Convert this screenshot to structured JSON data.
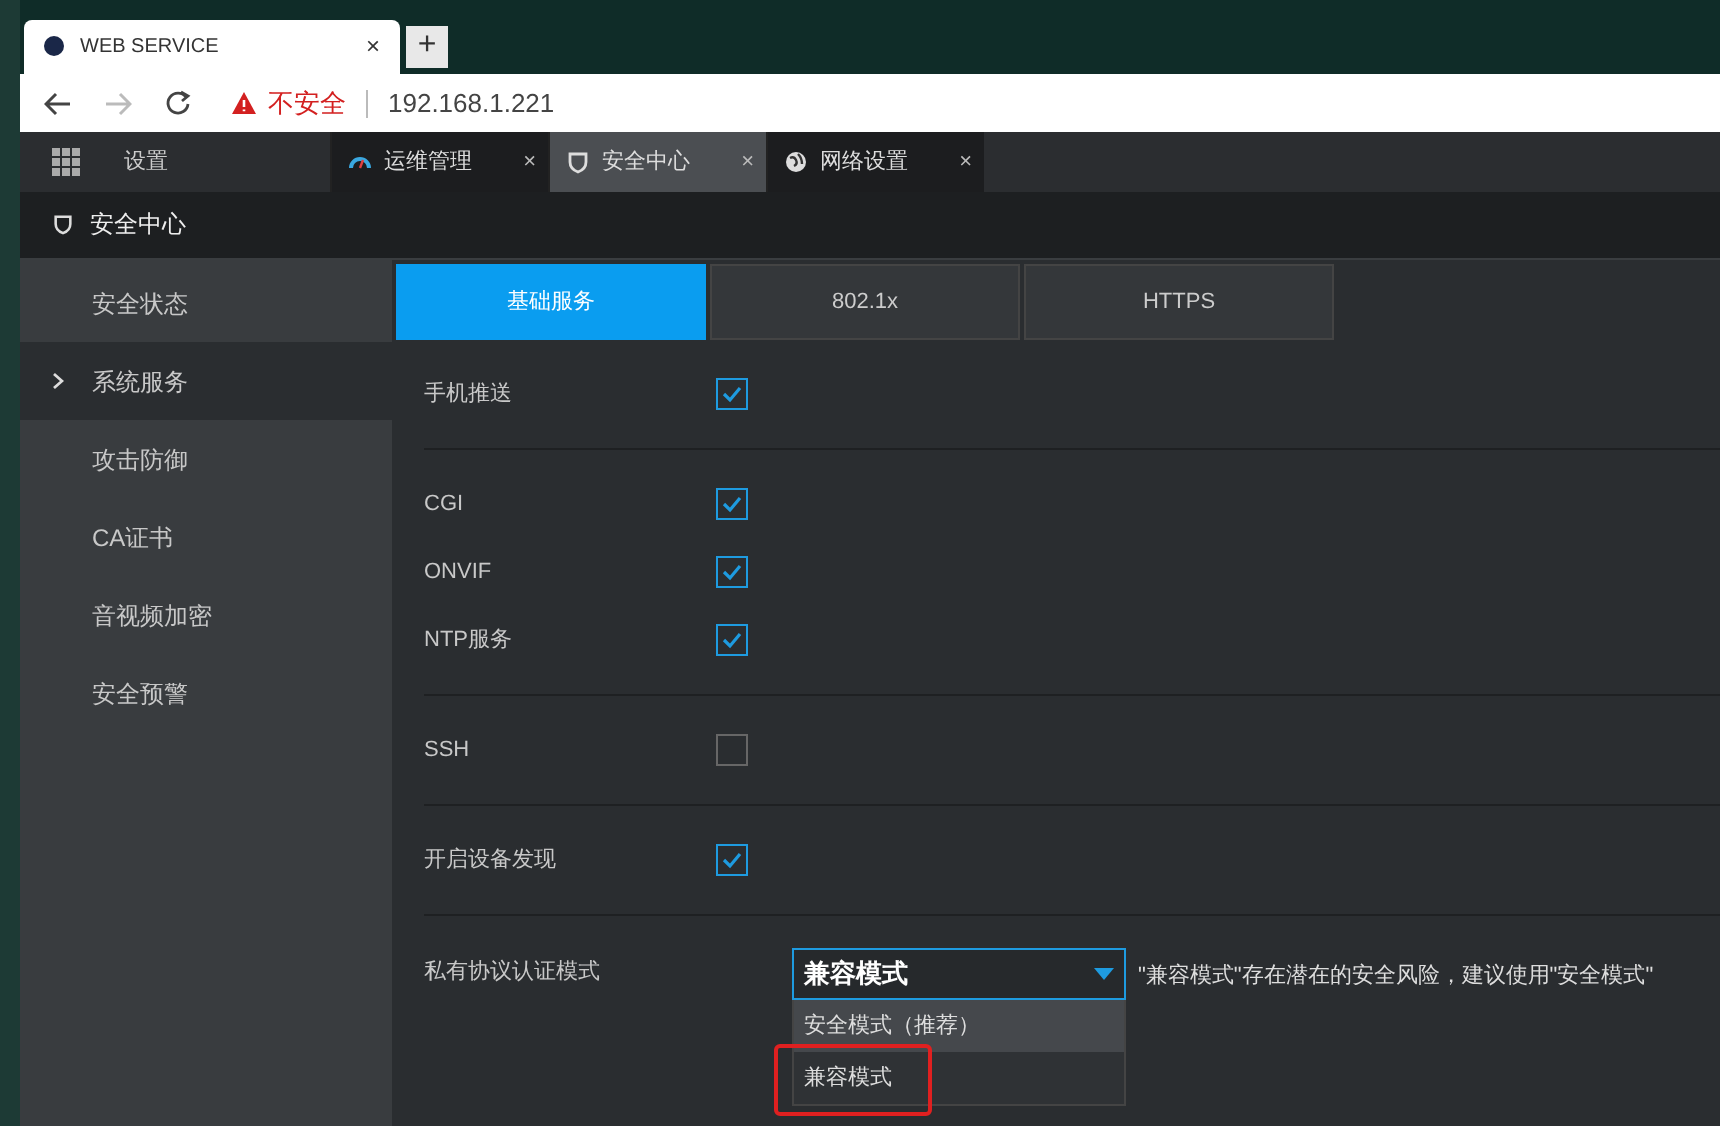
{
  "browser": {
    "tab_title": "WEB SERVICE",
    "security_label": "不安全",
    "address": "192.168.1.221",
    "new_tab": "+",
    "tab_close": "×"
  },
  "app_tabs": {
    "home_label": "设置",
    "tabs": [
      {
        "label": "运维管理",
        "selected": false,
        "close": "×"
      },
      {
        "label": "安全中心",
        "selected": true,
        "close": "×"
      },
      {
        "label": "网络设置",
        "selected": false,
        "close": "×"
      }
    ]
  },
  "header": {
    "title": "安全中心"
  },
  "sidebar": {
    "items": [
      {
        "label": "安全状态",
        "selected": false
      },
      {
        "label": "系统服务",
        "selected": true
      },
      {
        "label": "攻击防御",
        "selected": false
      },
      {
        "label": "CA证书",
        "selected": false
      },
      {
        "label": "音视频加密",
        "selected": false
      },
      {
        "label": "安全预警",
        "selected": false
      }
    ]
  },
  "tabs": [
    {
      "label": "基础服务",
      "selected": true
    },
    {
      "label": "802.1x",
      "selected": false
    },
    {
      "label": "HTTPS",
      "selected": false
    }
  ],
  "groups": [
    {
      "rows": [
        {
          "kind": "checkbox",
          "label": "手机推送",
          "checked": true
        }
      ]
    },
    {
      "rows": [
        {
          "kind": "checkbox",
          "label": "CGI",
          "checked": true
        },
        {
          "kind": "checkbox",
          "label": "ONVIF",
          "checked": true
        },
        {
          "kind": "checkbox",
          "label": "NTP服务",
          "checked": true
        }
      ]
    },
    {
      "rows": [
        {
          "kind": "checkbox",
          "label": "SSH",
          "checked": false
        }
      ]
    },
    {
      "rows": [
        {
          "kind": "checkbox",
          "label": "开启设备发现",
          "checked": true
        }
      ]
    },
    {
      "rows": [
        {
          "kind": "select",
          "label": "私有协议认证模式",
          "value": "兼容模式",
          "expanded": true,
          "hint": "\"兼容模式\"存在潜在的安全风险，建议使用\"安全模式\"",
          "options": [
            {
              "label": "安全模式（推荐）",
              "highlighted": true,
              "circled": false
            },
            {
              "label": "兼容模式",
              "highlighted": false,
              "circled": true
            }
          ]
        }
      ]
    }
  ]
}
